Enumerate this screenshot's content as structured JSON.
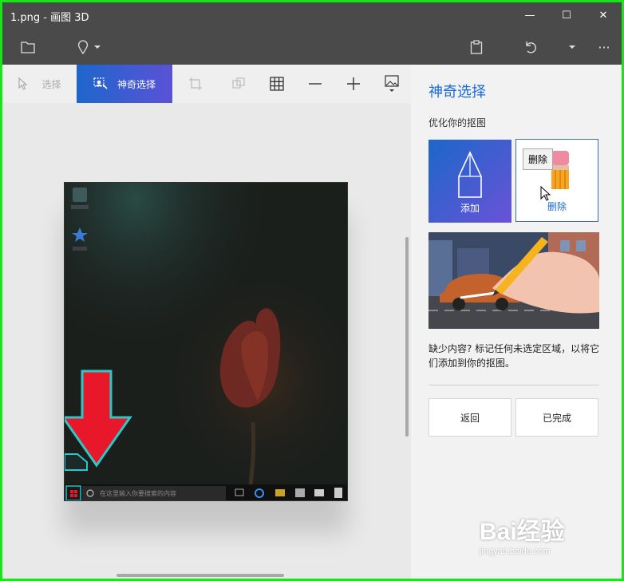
{
  "window": {
    "title": "1.png - 画图 3D",
    "minimize": "—",
    "maximize": "☐",
    "close": "✕"
  },
  "toolbar_top": {
    "more_label": "···"
  },
  "tools": {
    "select_label": "选择",
    "magic_select_label": "神奇选择"
  },
  "panel": {
    "title": "神奇选择",
    "subtitle": "优化你的抠图",
    "add_label": "添加",
    "remove_label": "删除",
    "tooltip": "删除",
    "description": "缺少内容? 标记任何未选定区域，以将它们添加到你的抠图。",
    "back_label": "返回",
    "done_label": "已完成"
  },
  "canvas_image": {
    "taskbar_search_placeholder": "在这里输入你要搜索的内容"
  },
  "watermark": {
    "text": "Bai经验",
    "sub": "jingyan.baidu.com"
  },
  "colors": {
    "accent": "#1a6bd6",
    "arrow_red": "#e8182a",
    "selection_outline": "#2ec7c7"
  }
}
